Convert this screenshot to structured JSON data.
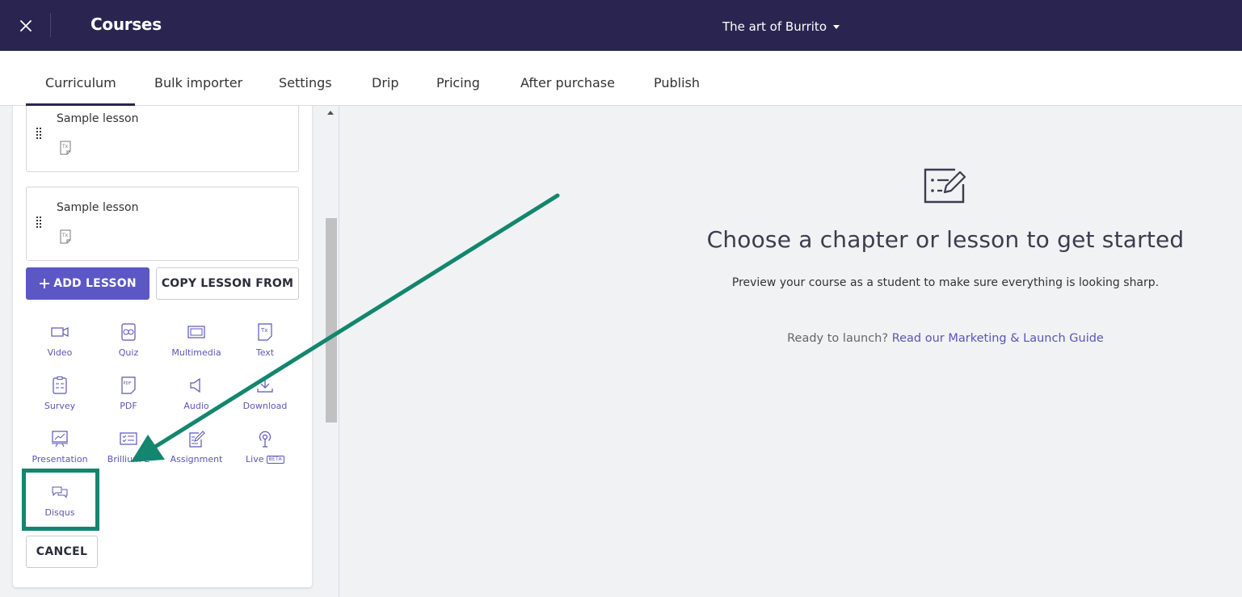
{
  "colors": {
    "topbar_bg": "#2a2550",
    "accent": "#5b57c5",
    "link": "#5a55b8",
    "annotation": "#12866e"
  },
  "header": {
    "close_icon": "close-icon",
    "title": "Courses",
    "course_selector": "The art of Burrito"
  },
  "tabs": [
    {
      "label": "Curriculum",
      "active": true
    },
    {
      "label": "Bulk importer"
    },
    {
      "label": "Settings"
    },
    {
      "label": "Drip"
    },
    {
      "label": "Pricing"
    },
    {
      "label": "After purchase"
    },
    {
      "label": "Publish"
    }
  ],
  "sidebar": {
    "lessons": [
      {
        "title": "Sample lesson",
        "icon": "text-lesson-icon"
      },
      {
        "title": "Sample lesson",
        "icon": "text-lesson-icon"
      }
    ],
    "add_lesson_label": "ADD LESSON",
    "copy_lesson_label": "COPY LESSON FROM",
    "lesson_types": [
      {
        "label": "Video",
        "icon": "video-icon"
      },
      {
        "label": "Quiz",
        "icon": "quiz-icon"
      },
      {
        "label": "Multimedia",
        "icon": "multimedia-icon"
      },
      {
        "label": "Text",
        "icon": "text-icon"
      },
      {
        "label": "Survey",
        "icon": "survey-icon"
      },
      {
        "label": "PDF",
        "icon": "pdf-icon"
      },
      {
        "label": "Audio",
        "icon": "audio-icon"
      },
      {
        "label": "Download",
        "icon": "download-icon"
      },
      {
        "label": "Presentation",
        "icon": "presentation-icon"
      },
      {
        "label": "Brillium E",
        "icon": "brillium-icon"
      },
      {
        "label": "Assignment",
        "icon": "assignment-icon"
      },
      {
        "label": "Live",
        "badge": "BETA",
        "icon": "live-icon"
      },
      {
        "label": "Disqus",
        "icon": "disqus-icon"
      }
    ],
    "cancel_label": "CANCEL"
  },
  "main": {
    "icon": "edit-list-icon",
    "title": "Choose a chapter or lesson to get started",
    "subtitle": "Preview your course as a student to make sure everything is looking sharp.",
    "launch_prefix": "Ready to launch? ",
    "launch_link": "Read our Marketing & Launch Guide"
  }
}
